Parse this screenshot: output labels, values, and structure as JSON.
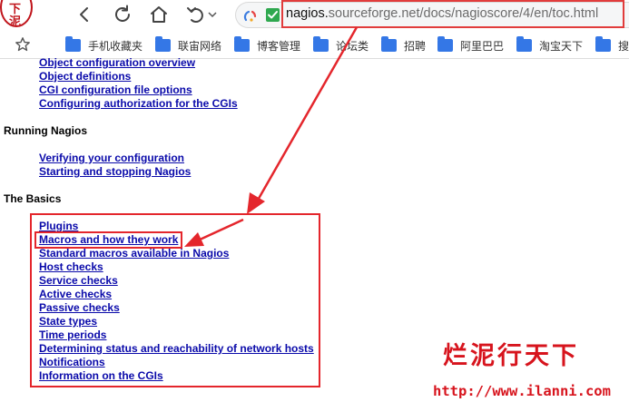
{
  "toolbar": {
    "logo_text": "下泥",
    "address": {
      "domain": "nagios.",
      "rest": "sourceforge.net/docs/nagioscore/4/en/toc.html"
    }
  },
  "bookmarks": [
    {
      "label": "手机收藏夹"
    },
    {
      "label": "联宙网络"
    },
    {
      "label": "博客管理"
    },
    {
      "label": "论坛类"
    },
    {
      "label": "招聘"
    },
    {
      "label": "阿里巴巴"
    },
    {
      "label": "淘宝天下"
    },
    {
      "label": "搜"
    }
  ],
  "toc": {
    "top_links": [
      "Object configuration overview",
      "Object definitions",
      "CGI configuration file options",
      "Configuring authorization for the CGIs"
    ],
    "running": {
      "heading": "Running Nagios",
      "links": [
        "Verifying your configuration",
        "Starting and stopping Nagios"
      ]
    },
    "basics": {
      "heading": "The Basics",
      "links": [
        "Plugins",
        "Macros and how they work",
        "Standard macros available in Nagios",
        "Host checks",
        "Service checks",
        "Active checks",
        "Passive checks",
        "State types",
        "Time periods",
        "Determining status and reachability of network hosts",
        "Notifications",
        "Information on the CGIs"
      ]
    }
  },
  "watermark": {
    "chinese": "烂泥行天下",
    "url": "http://www.ilanni.com"
  },
  "colors": {
    "link": "#0a0aaa",
    "annotation_red": "#e4262c",
    "watermark_red": "#d7141d",
    "folder_blue": "#3477e6"
  }
}
